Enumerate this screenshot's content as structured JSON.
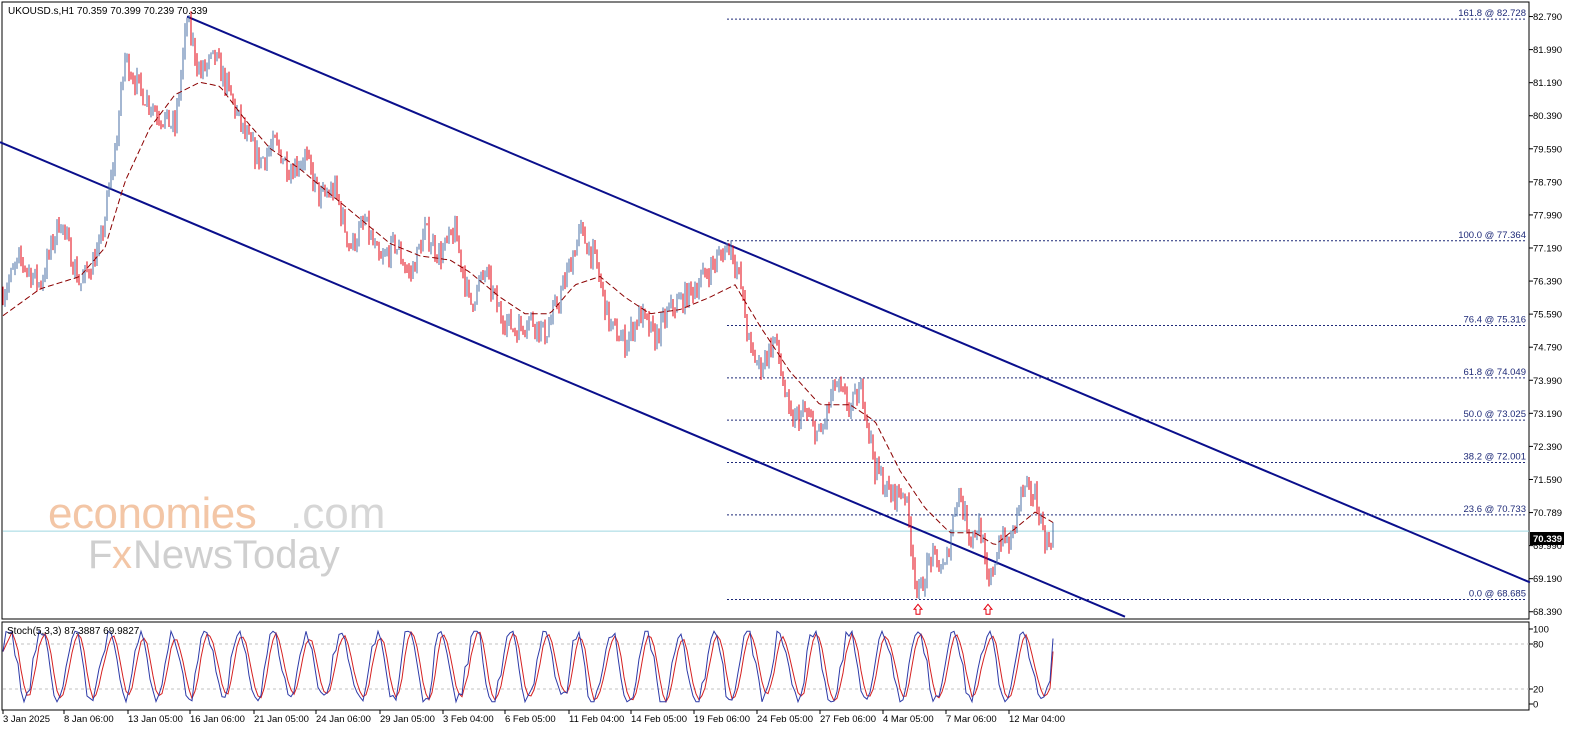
{
  "chart_title": "UKOUSD.s,H1  70.359 70.399 70.239 70.339",
  "current_price_label": "70.339",
  "watermark": {
    "line1_brand": "economies",
    "line1_suffix": ".com",
    "line2_a": "F",
    "line2_b": "x",
    "line2_c": "NewsToday"
  },
  "colors": {
    "up_candle": "#4a6fa5",
    "down_candle": "#e3000f",
    "moving_average": "#8b0000",
    "channel": "#0a0f8c",
    "fib_levels": "#1e2a78",
    "current_price_line": "#9fd8e0",
    "stoch_main": "#2d3aa8",
    "stoch_signal": "#d62020"
  },
  "chart_data": [
    {
      "type": "candlestick",
      "instrument": "UKOUSD.s",
      "timeframe": "H1",
      "ohlc_latest": {
        "open": 70.359,
        "high": 70.399,
        "low": 70.239,
        "close": 70.339
      },
      "ylim": [
        68.19,
        83.19
      ],
      "y_ticks": [
        "82.790",
        "81.990",
        "81.190",
        "80.390",
        "79.590",
        "78.790",
        "77.990",
        "77.190",
        "76.390",
        "75.590",
        "74.790",
        "73.990",
        "73.190",
        "72.390",
        "71.590",
        "70.789",
        "69.990",
        "69.190",
        "68.390"
      ],
      "x_tick_labels": [
        "3 Jan 2025",
        "8 Jan 06:00",
        "13 Jan 05:00",
        "16 Jan 06:00",
        "21 Jan 05:00",
        "24 Jan 06:00",
        "29 Jan 05:00",
        "3 Feb 04:00",
        "6 Feb 05:00",
        "11 Feb 04:00",
        "14 Feb 05:00",
        "19 Feb 06:00",
        "24 Feb 05:00",
        "27 Feb 06:00",
        "4 Mar 05:00",
        "7 Mar 06:00",
        "12 Mar 04:00"
      ],
      "price_path": [
        [
          0,
          76.0
        ],
        [
          20,
          76.9
        ],
        [
          40,
          76.3
        ],
        [
          60,
          77.9
        ],
        [
          80,
          76.3
        ],
        [
          100,
          77.2
        ],
        [
          115,
          79.5
        ],
        [
          125,
          81.8
        ],
        [
          140,
          81.0
        ],
        [
          160,
          80.4
        ],
        [
          175,
          80.1
        ],
        [
          187,
          82.7
        ],
        [
          200,
          81.4
        ],
        [
          215,
          81.8
        ],
        [
          230,
          80.9
        ],
        [
          245,
          79.9
        ],
        [
          260,
          79.3
        ],
        [
          275,
          79.7
        ],
        [
          290,
          79.1
        ],
        [
          305,
          79.4
        ],
        [
          320,
          78.4
        ],
        [
          335,
          78.6
        ],
        [
          350,
          77.2
        ],
        [
          365,
          77.8
        ],
        [
          380,
          76.8
        ],
        [
          395,
          77.3
        ],
        [
          410,
          76.5
        ],
        [
          425,
          77.6
        ],
        [
          440,
          77.0
        ],
        [
          455,
          77.6
        ],
        [
          470,
          75.8
        ],
        [
          485,
          76.6
        ],
        [
          500,
          75.6
        ],
        [
          515,
          75.2
        ],
        [
          530,
          75.5
        ],
        [
          545,
          75.1
        ],
        [
          560,
          76.0
        ],
        [
          580,
          77.6
        ],
        [
          595,
          76.9
        ],
        [
          610,
          75.3
        ],
        [
          625,
          74.9
        ],
        [
          640,
          75.6
        ],
        [
          655,
          75.0
        ],
        [
          670,
          75.7
        ],
        [
          690,
          76.1
        ],
        [
          710,
          76.7
        ],
        [
          730,
          77.3
        ],
        [
          740,
          76.4
        ],
        [
          750,
          74.7
        ],
        [
          760,
          74.3
        ],
        [
          775,
          75.0
        ],
        [
          790,
          73.0
        ],
        [
          805,
          73.2
        ],
        [
          820,
          72.6
        ],
        [
          835,
          73.9
        ],
        [
          850,
          73.3
        ],
        [
          862,
          73.8
        ],
        [
          875,
          71.9
        ],
        [
          890,
          71.2
        ],
        [
          905,
          71.3
        ],
        [
          918,
          68.7
        ],
        [
          930,
          69.7
        ],
        [
          945,
          69.4
        ],
        [
          958,
          71.4
        ],
        [
          970,
          70.2
        ],
        [
          980,
          70.5
        ],
        [
          988,
          68.9
        ],
        [
          1000,
          70.2
        ],
        [
          1010,
          70.0
        ],
        [
          1022,
          71.3
        ],
        [
          1035,
          71.2
        ],
        [
          1047,
          70.0
        ],
        [
          1053,
          70.34
        ]
      ],
      "moving_average_path": [
        [
          0,
          75.5
        ],
        [
          40,
          76.2
        ],
        [
          80,
          76.5
        ],
        [
          105,
          77.2
        ],
        [
          125,
          78.8
        ],
        [
          150,
          80.1
        ],
        [
          175,
          80.9
        ],
        [
          200,
          81.2
        ],
        [
          220,
          81.1
        ],
        [
          245,
          80.3
        ],
        [
          270,
          79.6
        ],
        [
          300,
          79.1
        ],
        [
          330,
          78.5
        ],
        [
          360,
          77.9
        ],
        [
          390,
          77.3
        ],
        [
          420,
          77.0
        ],
        [
          450,
          76.9
        ],
        [
          470,
          76.6
        ],
        [
          500,
          76.0
        ],
        [
          525,
          75.6
        ],
        [
          550,
          75.6
        ],
        [
          575,
          76.3
        ],
        [
          600,
          76.5
        ],
        [
          625,
          76.0
        ],
        [
          650,
          75.6
        ],
        [
          680,
          75.7
        ],
        [
          710,
          76.0
        ],
        [
          735,
          76.3
        ],
        [
          760,
          75.3
        ],
        [
          790,
          74.2
        ],
        [
          820,
          73.4
        ],
        [
          850,
          73.4
        ],
        [
          875,
          73.0
        ],
        [
          900,
          71.8
        ],
        [
          925,
          70.9
        ],
        [
          950,
          70.3
        ],
        [
          975,
          70.3
        ],
        [
          995,
          70.0
        ],
        [
          1015,
          70.4
        ],
        [
          1035,
          70.8
        ],
        [
          1053,
          70.55
        ]
      ],
      "channel_upper": {
        "from": [
          187,
          82.79
        ],
        "to": [
          1530,
          69.1
        ]
      },
      "channel_lower": {
        "from": [
          0,
          79.75
        ],
        "to": [
          1125,
          68.27
        ]
      },
      "fib_retracements": [
        {
          "label": "161.8 @ 82.728",
          "value": 82.728
        },
        {
          "label": "100.0 @ 77.364",
          "value": 77.364
        },
        {
          "label": "76.4 @ 75.316",
          "value": 75.316
        },
        {
          "label": "61.8 @ 74.049",
          "value": 74.049
        },
        {
          "label": "50.0 @ 73.025",
          "value": 73.025
        },
        {
          "label": "38.2 @ 72.001",
          "value": 72.001
        },
        {
          "label": "23.6 @ 70.733",
          "value": 70.733
        },
        {
          "label": "0.0 @ 68.685",
          "value": 68.685
        }
      ],
      "fractal_arrows_x": [
        918,
        988
      ],
      "current_price": 70.339,
      "grid": false
    },
    {
      "type": "line",
      "indicator": "Stochastic",
      "label": "Stoch(5,3,3) 87.3887 69.9827",
      "ylim": [
        0,
        100
      ],
      "y_ticks": [
        "100",
        "80",
        "20",
        "0"
      ],
      "levels": [
        80,
        20
      ],
      "main_value": 87.3887,
      "signal_value": 69.9827
    }
  ]
}
